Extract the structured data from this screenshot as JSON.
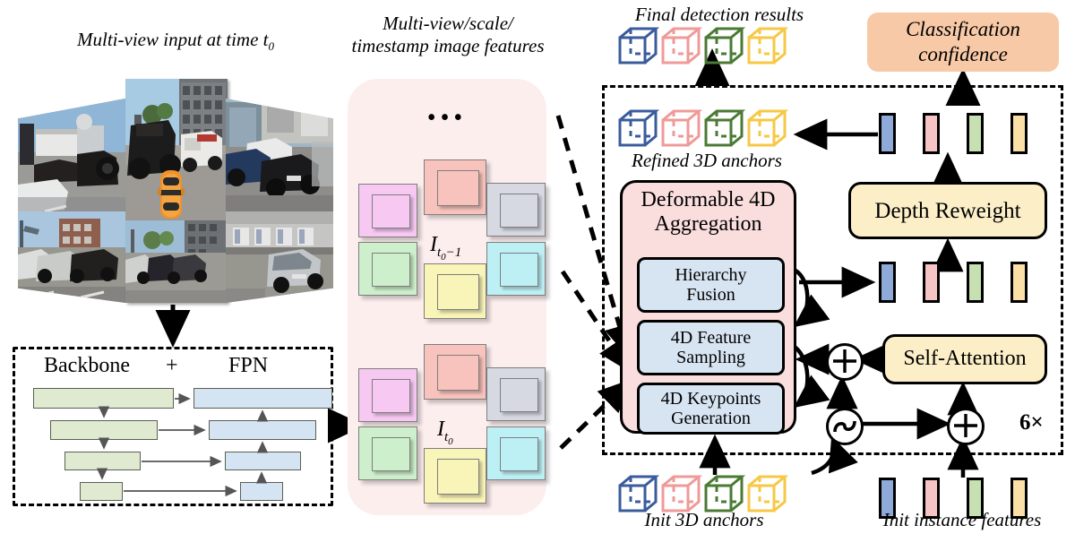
{
  "captions": {
    "multiview_input": "Multi-view input at time t",
    "multiview_input_sub": "0",
    "features_line1": "Multi-view/scale/",
    "features_line2": "timestamp image features",
    "final_detection": "Final detection results",
    "classification_line1": "Classification",
    "classification_line2": "confidence",
    "refined_anchors": "Refined 3D anchors",
    "init_anchors": "Init 3D anchors",
    "init_instance": "Init instance features",
    "dots": "•••"
  },
  "backbone": {
    "title_backbone": "Backbone",
    "title_plus": "+",
    "title_fpn": "FPN"
  },
  "features": {
    "label_prev": "I",
    "label_prev_sub": "t",
    "label_prev_sub2": "0",
    "label_prev_minus": "−1",
    "label_cur": "I",
    "label_cur_sub": "t",
    "label_cur_sub2": "0",
    "colors": [
      "#f6c8f2",
      "#f9c3bd",
      "#d6d8e2",
      "#cdefcb",
      "#f9f4b8",
      "#bdf0f5"
    ]
  },
  "module": {
    "dfa_line1": "Deformable 4D",
    "dfa_line2": "Aggregation",
    "hierarchy_fusion": "Hierarchy\nFusion",
    "feature_sampling": "4D Feature\nSampling",
    "keypoints_generation": "4D Keypoints\nGeneration",
    "depth_reweight": "Depth Reweight",
    "self_attention": "Self-Attention",
    "repeat": "6×"
  },
  "colors": {
    "cube_blue": "#3a5c9c",
    "cube_pink": "#f09a98",
    "cube_green": "#4a7a33",
    "cube_yellow": "#f6c845",
    "bar_blue": "#8fa9d8",
    "bar_pink": "#f6c4c4",
    "bar_green": "#c6e0b2",
    "bar_yellow": "#fbdfa6",
    "feature_bg": "#fdeeee",
    "dfa_bg": "#fadddd",
    "subbox_bg": "#d7e4f2",
    "yellow_box": "#fcefc8",
    "cls_box": "#f7c9a6",
    "backbone_green": "#dfead0",
    "fpn_blue": "#d5e4f3"
  },
  "backbone_rows": [
    {
      "g_w": 160,
      "b_w": 160
    },
    {
      "g_w": 120,
      "b_w": 120
    },
    {
      "g_w": 84,
      "b_w": 84
    },
    {
      "g_w": 48,
      "b_w": 48
    }
  ]
}
